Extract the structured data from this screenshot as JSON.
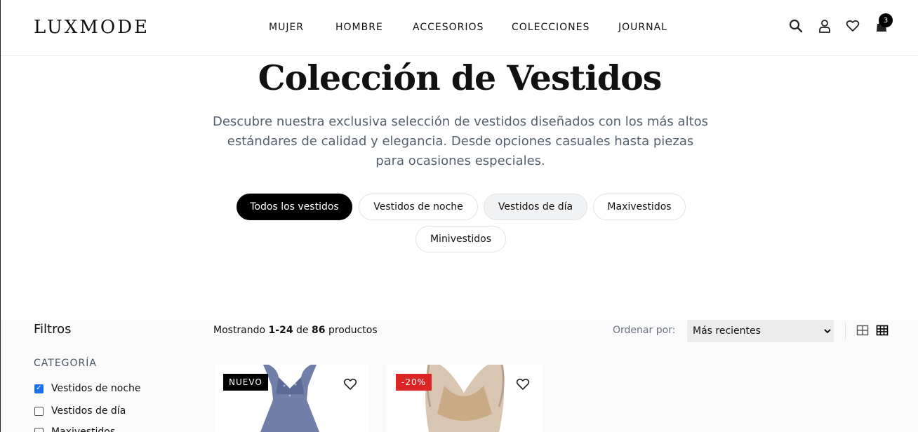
{
  "brand": {
    "logo": "LUXMODE"
  },
  "nav": {
    "items": [
      "MUJER",
      "HOMBRE",
      "ACCESORIOS",
      "COLECCIONES",
      "JOURNAL"
    ]
  },
  "header_icons": {
    "search": "search-icon",
    "account": "user-icon",
    "wishlist": "heart-icon",
    "cart": "shopping-bag-icon",
    "cart_count": "3"
  },
  "hero": {
    "title": "Colección de Vestidos",
    "description": "Descubre nuestra exclusiva selección de vestidos diseñados con los más altos estándares de calidad y elegancia. Desde opciones casuales hasta piezas para ocasiones especiales."
  },
  "category_pills": [
    {
      "label": "Todos los vestidos",
      "active": true
    },
    {
      "label": "Vestidos de noche",
      "active": false
    },
    {
      "label": "Vestidos de día",
      "active": false
    },
    {
      "label": "Maxivestidos",
      "active": false
    },
    {
      "label": "Minivestidos",
      "active": false
    }
  ],
  "filters": {
    "title": "Filtros",
    "category_heading": "CATEGORÍA",
    "options": [
      {
        "label": "Vestidos de noche",
        "checked": true
      },
      {
        "label": "Vestidos de día",
        "checked": false
      },
      {
        "label": "Maxivestidos",
        "checked": false
      }
    ]
  },
  "results": {
    "prefix": "Mostrando",
    "range": "1-24",
    "of": "de",
    "total": "86",
    "suffix": "productos"
  },
  "sort": {
    "label": "Ordenar por:",
    "selected": "Más recientes"
  },
  "products": [
    {
      "badge": "NUEVO",
      "badge_type": "new",
      "dress_color": "#6f7fa8"
    },
    {
      "badge": "-20%",
      "badge_type": "sale",
      "dress_color": "#c9ab86"
    }
  ],
  "colors": {
    "accent": "#000000",
    "sale": "#dc2626",
    "checkbox": "#1a73e8"
  }
}
